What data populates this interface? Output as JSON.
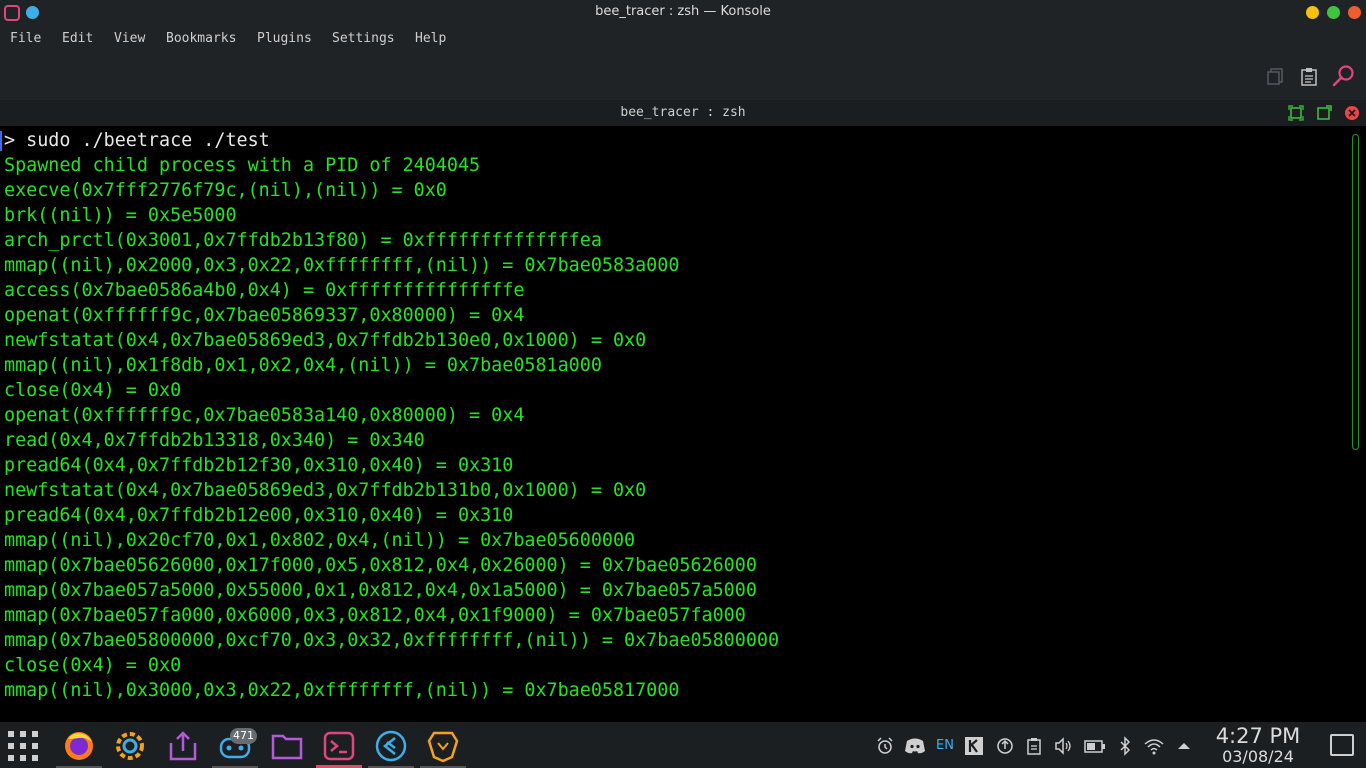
{
  "window": {
    "title": "bee_tracer : zsh — Konsole"
  },
  "menubar": {
    "items": [
      "File",
      "Edit",
      "View",
      "Bookmarks",
      "Plugins",
      "Settings",
      "Help"
    ]
  },
  "tab": {
    "title": "bee_tracer : zsh"
  },
  "terminal": {
    "prompt": "> sudo ./beetrace ./test",
    "lines": [
      "Spawned child process with a PID of 2404045",
      "execve(0x7fff2776f79c,(nil),(nil)) = 0x0",
      "brk((nil)) = 0x5e5000",
      "arch_prctl(0x3001,0x7ffdb2b13f80) = 0xffffffffffffffea",
      "mmap((nil),0x2000,0x3,0x22,0xffffffff,(nil)) = 0x7bae0583a000",
      "access(0x7bae0586a4b0,0x4) = 0xfffffffffffffffe",
      "openat(0xffffff9c,0x7bae05869337,0x80000) = 0x4",
      "newfstatat(0x4,0x7bae05869ed3,0x7ffdb2b130e0,0x1000) = 0x0",
      "mmap((nil),0x1f8db,0x1,0x2,0x4,(nil)) = 0x7bae0581a000",
      "close(0x4) = 0x0",
      "openat(0xffffff9c,0x7bae0583a140,0x80000) = 0x4",
      "read(0x4,0x7ffdb2b13318,0x340) = 0x340",
      "pread64(0x4,0x7ffdb2b12f30,0x310,0x40) = 0x310",
      "newfstatat(0x4,0x7bae05869ed3,0x7ffdb2b131b0,0x1000) = 0x0",
      "pread64(0x4,0x7ffdb2b12e00,0x310,0x40) = 0x310",
      "mmap((nil),0x20cf70,0x1,0x802,0x4,(nil)) = 0x7bae05600000",
      "mmap(0x7bae05626000,0x17f000,0x5,0x812,0x4,0x26000) = 0x7bae05626000",
      "mmap(0x7bae057a5000,0x55000,0x1,0x812,0x4,0x1a5000) = 0x7bae057a5000",
      "mmap(0x7bae057fa000,0x6000,0x3,0x812,0x4,0x1f9000) = 0x7bae057fa000",
      "mmap(0x7bae05800000,0xcf70,0x3,0x32,0xffffffff,(nil)) = 0x7bae05800000",
      "close(0x4) = 0x0",
      "mmap((nil),0x3000,0x3,0x22,0xffffffff,(nil)) = 0x7bae05817000"
    ]
  },
  "taskbar": {
    "apps": [
      {
        "icon": "app-launcher-icon"
      },
      {
        "icon": "firefox-icon"
      },
      {
        "icon": "system-settings-icon"
      },
      {
        "icon": "discover-icon"
      },
      {
        "icon": "steam-icon",
        "badge": "471"
      },
      {
        "icon": "dolphin-files-icon"
      },
      {
        "icon": "konsole-icon"
      },
      {
        "icon": "vscode-icon"
      },
      {
        "icon": "brave-icon"
      }
    ],
    "tray": {
      "language": "EN"
    },
    "clock": {
      "time": "4:27 PM",
      "date": "03/08/24"
    }
  },
  "colors": {
    "terminal_fg": "#27e027",
    "terminal_bg": "#000000",
    "accent": "#3daee9",
    "active_task": "#e04b6a"
  }
}
